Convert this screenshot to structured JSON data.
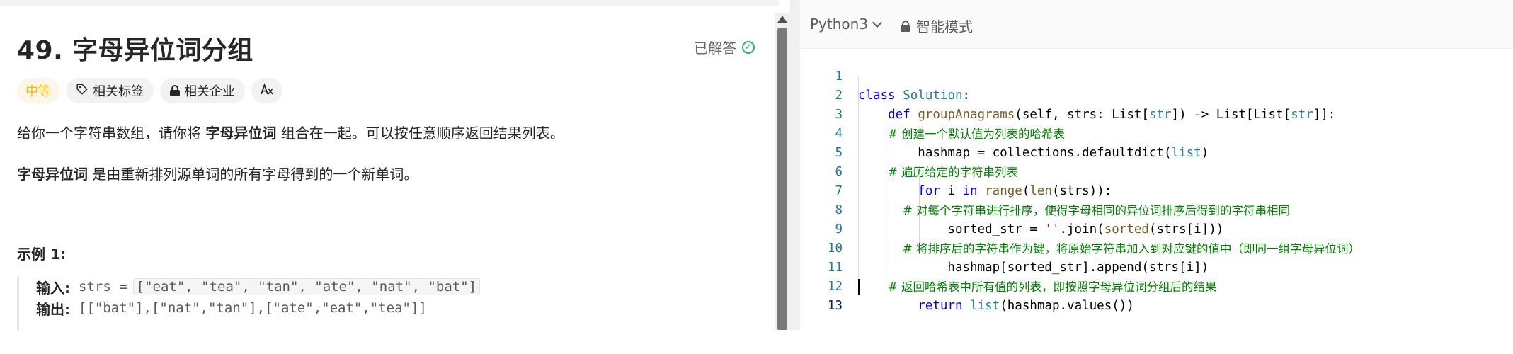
{
  "problem": {
    "title": "49. 字母异位词分组",
    "solved_label": "已解答",
    "tags": [
      {
        "label": "中等",
        "icon": ""
      },
      {
        "label": "相关标签",
        "icon": "tag-icon"
      },
      {
        "label": "相关企业",
        "icon": "lock-icon"
      },
      {
        "label": "",
        "icon": "translate-icon"
      }
    ],
    "description": {
      "p1_before": "给你一个字符串数组，请你将 ",
      "p1_bold": "字母异位词",
      "p1_after": " 组合在一起。可以按任意顺序返回结果列表。",
      "p2_bold": "字母异位词",
      "p2_after": " 是由重新排列源单词的所有字母得到的一个新单词。"
    },
    "example": {
      "title": "示例 1:",
      "input_label": "输入:",
      "input_var": "strs = ",
      "input_value": "[\"eat\", \"tea\", \"tan\", \"ate\", \"nat\", \"bat\"]",
      "output_label": "输出:",
      "output_value": "[[\"bat\"],[\"nat\",\"tan\"],[\"ate\",\"eat\",\"tea\"]]"
    }
  },
  "editor": {
    "language": "Python3",
    "mode_label": "智能模式",
    "line_numbers": [
      "1",
      "2",
      "3",
      "4",
      "5",
      "6",
      "7",
      "8",
      "9",
      "10",
      "11",
      "12",
      "13"
    ],
    "code": [
      "class Solution:",
      "    def groupAnagrams(self, strs: List[str]) -> List[List[str]]:",
      "        # 创建一个默认值为列表的哈希表",
      "        hashmap = collections.defaultdict(list)",
      "        # 遍历给定的字符串列表",
      "        for i in range(len(strs)):",
      "            # 对每个字符串进行排序，使得字母相同的异位词排序后得到的字符串相同",
      "            sorted_str = ''.join(sorted(strs[i]))",
      "            # 将排序后的字符串作为键，将原始字符串加入到对应键的值中（即同一组字母异位词）",
      "            hashmap[sorted_str].append(strs[i])",
      "        # 返回哈希表中所有值的列表，即按照字母异位词分组后的结果",
      "        return list(hashmap.values())",
      ""
    ]
  },
  "colors": {
    "difficulty_medium": "#ffb800",
    "solved_check": "#2db55d",
    "keyword": "#0000ff",
    "class_name": "#267f99",
    "function": "#795e26",
    "comment": "#008000",
    "string": "#a31515",
    "line_number": "#237893"
  }
}
